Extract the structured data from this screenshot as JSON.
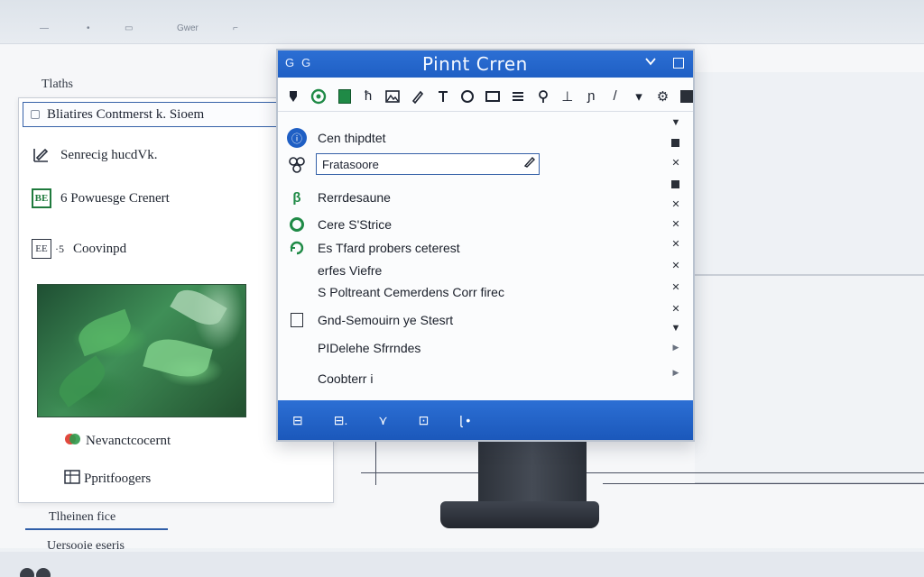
{
  "background": {
    "top_labels": [
      "—",
      "•",
      "▭",
      "Gwer",
      "⌐"
    ]
  },
  "side_panel": {
    "title": "Tlaths",
    "header": "Bliatires  Contmerst k.  Sioem",
    "items": [
      {
        "icon": "pen-icon",
        "label": "Senrecig hucdVk."
      },
      {
        "icon": "grid-icon",
        "label": "6 Powuesge Crenert",
        "badge": "BE"
      },
      {
        "icon": "calendar-icon",
        "label": "Coovinpd",
        "badge": "EE",
        "prefix": "·5"
      }
    ],
    "footer_items": [
      {
        "icon": "colorwheel-icon",
        "label": "Nevanctcocernt"
      },
      {
        "icon": "table-icon",
        "label": "Ppritfoogers"
      }
    ],
    "bottom_tab": "Tlheinen fice",
    "bottom_label": "Uersooie eseris"
  },
  "window": {
    "title": "Pinnt Crren",
    "titlebar_left": [
      "G",
      "G"
    ],
    "toolbar_glyphs": [
      "g",
      "⚘",
      "",
      "ħ",
      "ɗ",
      "⁄",
      "☐",
      "",
      "",
      "⊟",
      "⍝",
      "⊥",
      "ɲ",
      "/",
      "▾",
      "⚙",
      ""
    ],
    "rows": [
      {
        "icon": "info-icon",
        "label": "Cen thipdtet"
      },
      {
        "icon": "puzzle-icon",
        "label": ""
      },
      {
        "icon": "leaf-icon",
        "label": "Rerrdesaune"
      },
      {
        "icon": "circle-icon",
        "label": "Cere S'Strice"
      },
      {
        "icon": "refresh-icon",
        "label": "Es Tfard probers ceterest"
      },
      {
        "icon": "",
        "label": "erfes Viefre"
      },
      {
        "icon": "",
        "label": "S Poltreant Cemerdens Corr firec"
      },
      {
        "icon": "document-icon",
        "label": "Gnd-Semouirn ye Stesrt"
      },
      {
        "icon": "",
        "label": "PIDelehe Sfrrndes"
      },
      {
        "icon": "",
        "label": "Coobterr i"
      }
    ],
    "search": {
      "value": "Fratasoore",
      "placeholder": "Fratasoore"
    },
    "side_markers": [
      "▼",
      "■",
      "✕",
      "■",
      "✕",
      "✕",
      "✕",
      "✕",
      "✕",
      "✕",
      "▼",
      "▶",
      "▶"
    ],
    "statusbar_glyphs": [
      "⊟",
      "⊟.",
      "⋎",
      "⊡",
      "ɭ •"
    ]
  },
  "colors": {
    "accent": "#1f5fc4",
    "green": "#1f8a46"
  }
}
